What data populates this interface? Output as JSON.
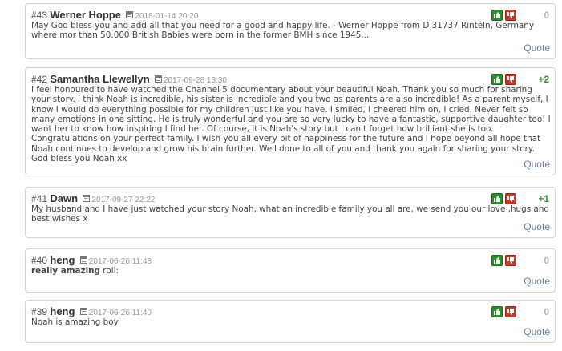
{
  "quote_label": "Quote",
  "comments": [
    {
      "number": "#43",
      "author": "Werner Hoppe",
      "date": "2018-01-14 20:20",
      "score": "0",
      "text": "May God bless you and add all that you need for a good and happy life. - Werner Hoppe from D 31737 Rinteln, Germany where mor than 50.000 British Babies were born in the former BMH since 1945..."
    },
    {
      "number": "#42",
      "author": "Samantha Llewellyn",
      "date": "2017-09-28 13:30",
      "score": "+2",
      "text": "I feel honoured to have watched the Channel 5 documentary about your beautiful Noah. Thank you so much for sharing your story. I think Noah is incredible, his sister is incredible and you two as parents are also incredible! As a parent myself, I know I would do everything possible for my children just like you have. I smiled, I cheered him on, I cried. Never felt so many emotions in one sitting. He is truly wonderful and you are so very lucky to have a fantastic, supportive daughter too! I want her to know how inspiring I find her. Of course, it is Noah's story but I can't forget how brilliant she is too. Congratulations on your perfect family. I wish you all every bit of happiness for the future and I hope beyond all hope that Noah continues to develop and grow his brain further. Well done to all of you and thank you again for sharing your story. God bless you Noah xx"
    },
    {
      "number": "#41",
      "author": "Dawn",
      "date": "2017-09-27 22:22",
      "score": "+1",
      "text": "My husband and I have just watched your story Noah, what an incredible family you all are, we send you our love ,hugs and best wishes x"
    },
    {
      "number": "#40",
      "author": "heng",
      "date": "2017-06-26 11:48",
      "score": "0",
      "text_bold": "really amazing",
      "text": " roll:"
    },
    {
      "number": "#39",
      "author": "heng",
      "date": "2017-06-26 11:40",
      "score": "0",
      "text": "Noah is amazing boy"
    }
  ],
  "icons": {
    "vote_up": "thumbs-up-icon",
    "vote_down": "thumbs-down-icon",
    "date": "calendar-icon"
  },
  "colors": {
    "vote_up": "#2f8f2f",
    "vote_down": "#c23a2a",
    "score_positive": "#339933",
    "score_zero": "#b5b5b5",
    "quote_link": "#6a7f99"
  }
}
